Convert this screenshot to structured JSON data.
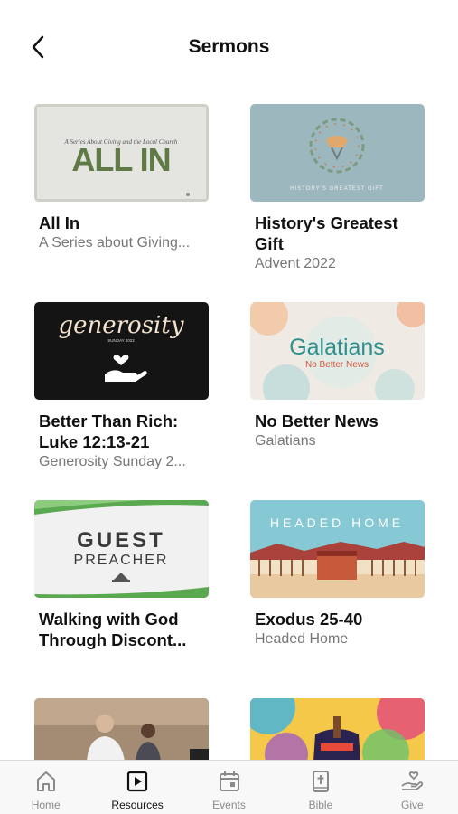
{
  "header": {
    "title": "Sermons"
  },
  "thumbnails": {
    "all_in_tagline": "A Series About Giving and the Local Church",
    "all_in_word": "ALL IN",
    "history_caption": "HISTORY'S GREATEST GIFT",
    "generosity_word": "generosity",
    "generosity_date": "SUNDAY 2022",
    "galatians_word": "Galatians",
    "galatians_tag": "No Better News",
    "guest_word": "GUEST",
    "preacher_word": "PREACHER",
    "headed_home_word": "HEADED HOME"
  },
  "sermons": [
    {
      "title": "All In",
      "subtitle": "A Series about Giving..."
    },
    {
      "title": "History's Greatest Gift",
      "subtitle": "Advent 2022"
    },
    {
      "title": "Better Than Rich: Luke 12:13-21",
      "subtitle": "Generosity Sunday 2..."
    },
    {
      "title": "No Better News",
      "subtitle": "Galatians"
    },
    {
      "title": "Walking with God Through Discont...",
      "subtitle": ""
    },
    {
      "title": "Exodus 25-40",
      "subtitle": "Headed Home"
    }
  ],
  "tabs": [
    {
      "label": "Home",
      "icon": "home-icon",
      "active": false
    },
    {
      "label": "Resources",
      "icon": "play-square-icon",
      "active": true
    },
    {
      "label": "Events",
      "icon": "calendar-icon",
      "active": false
    },
    {
      "label": "Bible",
      "icon": "bible-icon",
      "active": false
    },
    {
      "label": "Give",
      "icon": "giving-hand-icon",
      "active": false
    }
  ],
  "colors": {
    "active_tab": "#111111",
    "inactive_tab": "#8a8a8a"
  }
}
